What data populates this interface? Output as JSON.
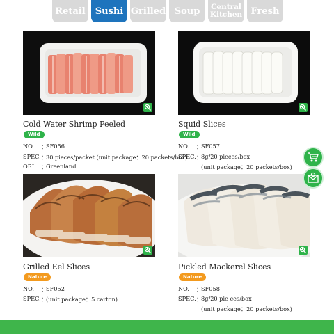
{
  "tabs": [
    {
      "label": "Retail"
    },
    {
      "label": "Sushi"
    },
    {
      "label": "Grilled"
    },
    {
      "label": "Soup"
    },
    {
      "label": "Central Kitchen",
      "line1": "Central",
      "line2": "Kitchen"
    },
    {
      "label": "Fresh"
    }
  ],
  "active_tab": "Sushi",
  "products": [
    {
      "name": "Cold Water Shrimp Peeled",
      "badge": "Wild",
      "no_label": "NO.",
      "no": "SF056",
      "spec_label": "SPEC.",
      "spec": "30 pieces/packet (unit package：20 packets/box)",
      "ori_label": "ORI.",
      "ori": "Greenland"
    },
    {
      "name": "Squid  Slices",
      "badge": "Wild",
      "no_label": "NO.",
      "no": "SF057",
      "spec_label": "SPEC.",
      "spec": "8g/20 pieces/box",
      "spec2": "(unit package：20 packets/box)"
    },
    {
      "name": "Grilled Eel Slices",
      "badge": "Nature",
      "no_label": "NO.",
      "no": "SF052",
      "spec_label": "SPEC.",
      "spec": "(unit package：5 carton)"
    },
    {
      "name": "Pickled Mackerel Slices",
      "badge": "Nature",
      "no_label": "NO.",
      "no": "SF058",
      "spec_label": "SPEC.",
      "spec": "8g/20 pie ces/box",
      "spec2": "(unit package：20 packets/box)"
    }
  ],
  "colon": "：",
  "icons": {
    "zoom": "zoom-in-icon",
    "cart": "shopping-cart-icon",
    "mail": "envelope-icon"
  },
  "colors": {
    "accent": "#1e74bd",
    "green": "#2fb34a",
    "orange": "#f39a1e",
    "tab_inactive": "#d9d9d9"
  }
}
